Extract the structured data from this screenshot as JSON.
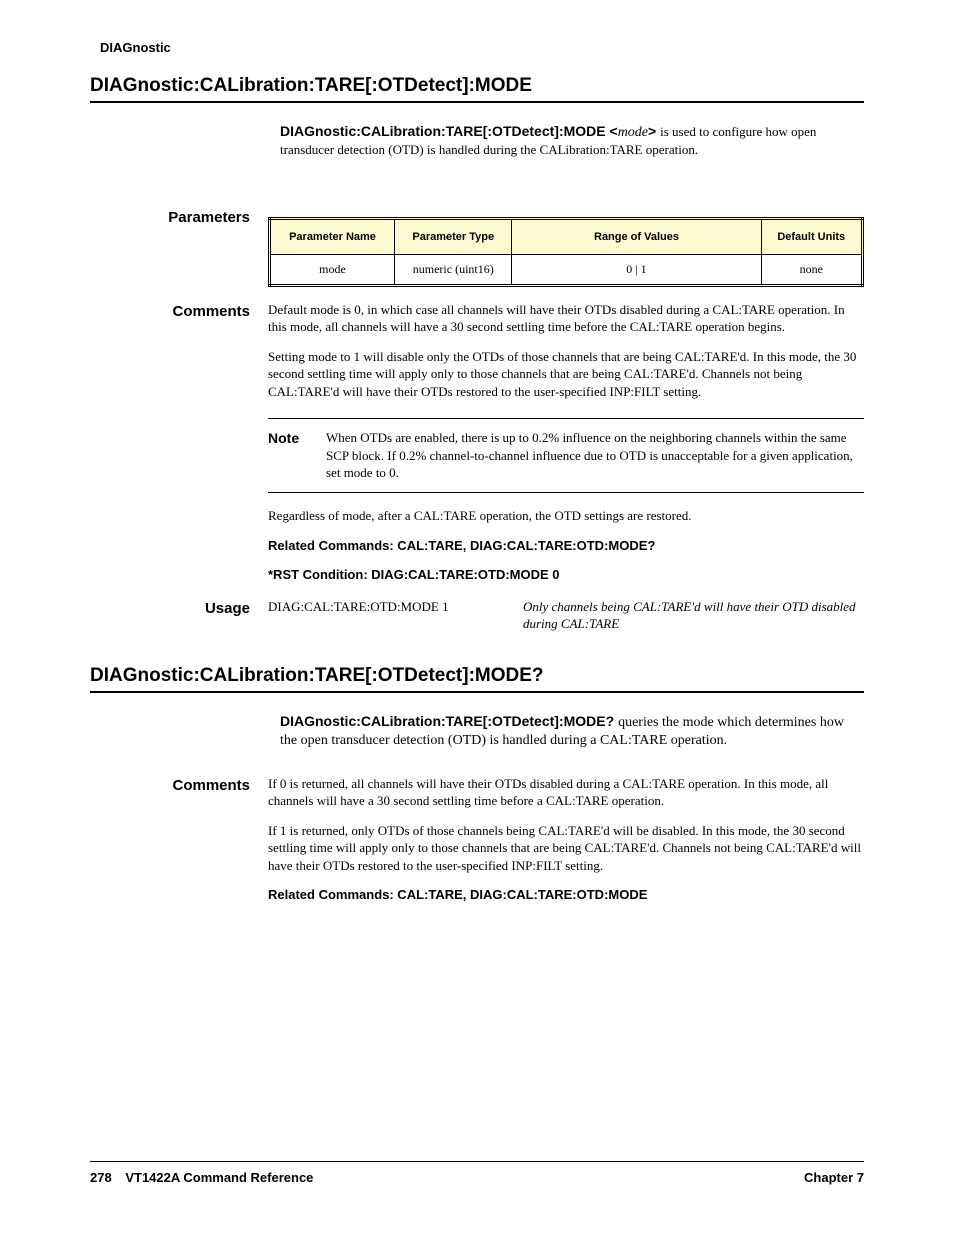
{
  "running_head": "DIAGnostic",
  "section1": {
    "title": "DIAGnostic:CALibration:TARE[:OTDetect]:MODE",
    "syntax_bold": "DIAGnostic:CALibration:TARE[:OTDetect]:MODE  <",
    "syntax_ital": "mode",
    "syntax_close": ">",
    "desc": "is used to configure how open transducer detection (OTD) is handled during the CALibration:TARE operation.",
    "parameters_label": "Parameters",
    "param_headers": [
      "Parameter Name",
      "Parameter Type",
      "Range of Values",
      "Default Units"
    ],
    "param_row": [
      "mode",
      "numeric (uint16)",
      "0 | 1",
      "none"
    ],
    "comments_label": "Comments",
    "comment1": "Default mode is 0, in which case all channels will have their OTDs disabled during a CAL:TARE operation. In this mode, all channels will have a 30 second settling time before the CAL:TARE operation begins.",
    "comment2": "Setting mode to 1 will disable only the OTDs of those channels that are being CAL:TARE'd. In this mode, the 30 second settling time will apply only to those channels that are being CAL:TARE'd. Channels not being CAL:TARE'd will have their OTDs restored to the user-specified INP:FILT setting.",
    "note_label": "Note",
    "note_body": "When OTDs are enabled, there is up to 0.2% influence on the neighboring channels within the same SCP block. If 0.2% channel-to-channel influence due to OTD is unacceptable for a given application, set mode to 0.",
    "comment3": "Regardless of mode, after a CAL:TARE operation, the OTD settings are restored.",
    "related": "Related Commands: CAL:TARE, DIAG:CAL:TARE:OTD:MODE?",
    "reset": "*RST Condition: DIAG:CAL:TARE:OTD:MODE 0",
    "usage_label": "Usage",
    "usage1_cmd": "DIAG:CAL:TARE:OTD:MODE 1",
    "usage1_expl": "Only channels being CAL:TARE'd will have their OTD disabled during CAL:TARE"
  },
  "section2": {
    "title": "DIAGnostic:CALibration:TARE[:OTDetect]:MODE?",
    "syntax_bold": "DIAGnostic:CALibration:TARE[:OTDetect]:MODE?",
    "desc": "queries the mode which determines how the open transducer detection (OTD) is handled during a CAL:TARE operation.",
    "comments_label": "Comments",
    "comment1": "If 0 is returned, all channels will have their OTDs disabled during a CAL:TARE operation. In this mode, all channels will have a 30 second settling time before a CAL:TARE operation.",
    "comment2": "If 1 is returned, only OTDs of those channels being CAL:TARE'd will be disabled. In this mode, the 30 second settling time will apply only to those channels that are being CAL:TARE'd. Channels not being CAL:TARE'd will have their OTDs restored to the user-specified INP:FILT setting.",
    "related": "Related Commands: CAL:TARE, DIAG:CAL:TARE:OTD:MODE"
  },
  "footer": {
    "page": "278",
    "doc": "VT1422A Command Reference",
    "chapter": "Chapter 7"
  }
}
